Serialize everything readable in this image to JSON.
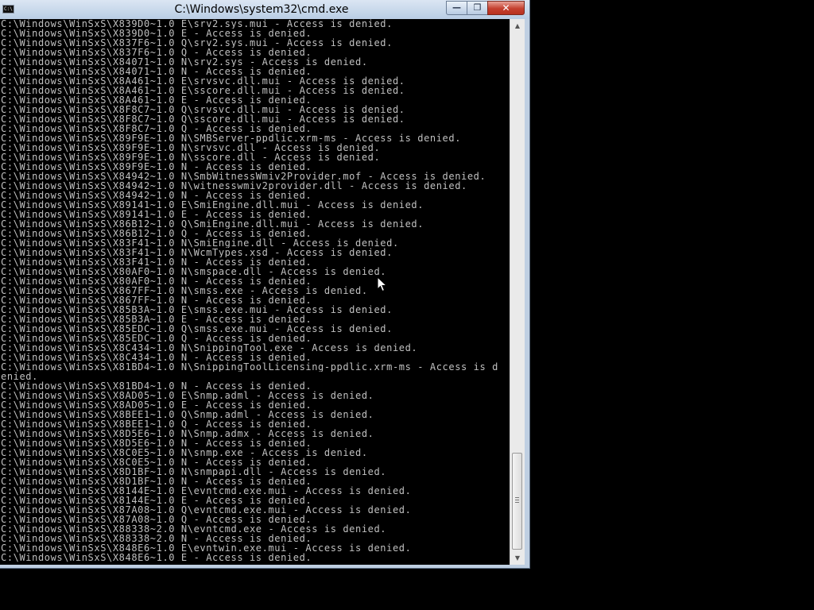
{
  "window": {
    "title": "C:\\Windows\\system32\\cmd.exe",
    "icon_text": "C:\\",
    "minimize_symbol": "—",
    "maximize_symbol": "❐",
    "close_symbol": "✕"
  },
  "scrollbar": {
    "up_symbol": "▲",
    "down_symbol": "▼",
    "position_fraction": 0.97
  },
  "console": {
    "lines": [
      "C:\\Windows\\WinSxS\\X839D0~1.0_E\\srv2.sys.mui - Access is denied.",
      "C:\\Windows\\WinSxS\\X839D0~1.0_E - Access is denied.",
      "C:\\Windows\\WinSxS\\X837F6~1.0_Q\\srv2.sys.mui - Access is denied.",
      "C:\\Windows\\WinSxS\\X837F6~1.0_Q - Access is denied.",
      "C:\\Windows\\WinSxS\\X84071~1.0_N\\srv2.sys - Access is denied.",
      "C:\\Windows\\WinSxS\\X84071~1.0_N - Access is denied.",
      "C:\\Windows\\WinSxS\\X8A461~1.0_E\\srvsvc.dll.mui - Access is denied.",
      "C:\\Windows\\WinSxS\\X8A461~1.0_E\\sscore.dll.mui - Access is denied.",
      "C:\\Windows\\WinSxS\\X8A461~1.0_E - Access is denied.",
      "C:\\Windows\\WinSxS\\X8F8C7~1.0_Q\\srvsvc.dll.mui - Access is denied.",
      "C:\\Windows\\WinSxS\\X8F8C7~1.0_Q\\sscore.dll.mui - Access is denied.",
      "C:\\Windows\\WinSxS\\X8F8C7~1.0_Q - Access is denied.",
      "C:\\Windows\\WinSxS\\X89F9E~1.0_N\\SMBServer-ppdlic.xrm-ms - Access is denied.",
      "C:\\Windows\\WinSxS\\X89F9E~1.0_N\\srvsvc.dll - Access is denied.",
      "C:\\Windows\\WinSxS\\X89F9E~1.0_N\\sscore.dll - Access is denied.",
      "C:\\Windows\\WinSxS\\X89F9E~1.0_N - Access is denied.",
      "C:\\Windows\\WinSxS\\X84942~1.0_N\\SmbWitnessWmiv2Provider.mof - Access is denied.",
      "C:\\Windows\\WinSxS\\X84942~1.0_N\\witnesswmiv2provider.dll - Access is denied.",
      "C:\\Windows\\WinSxS\\X84942~1.0_N - Access is denied.",
      "C:\\Windows\\WinSxS\\X89141~1.0_E\\SmiEngine.dll.mui - Access is denied.",
      "C:\\Windows\\WinSxS\\X89141~1.0_E - Access is denied.",
      "C:\\Windows\\WinSxS\\X86B12~1.0_Q\\SmiEngine.dll.mui - Access is denied.",
      "C:\\Windows\\WinSxS\\X86B12~1.0_Q - Access is denied.",
      "C:\\Windows\\WinSxS\\X83F41~1.0_N\\SmiEngine.dll - Access is denied.",
      "C:\\Windows\\WinSxS\\X83F41~1.0_N\\WcmTypes.xsd - Access is denied.",
      "C:\\Windows\\WinSxS\\X83F41~1.0_N - Access is denied.",
      "C:\\Windows\\WinSxS\\X80AF0~1.0_N\\smspace.dll - Access is denied.",
      "C:\\Windows\\WinSxS\\X80AF0~1.0_N - Access is denied.",
      "C:\\Windows\\WinSxS\\X867FF~1.0_N\\smss.exe - Access is denied.",
      "C:\\Windows\\WinSxS\\X867FF~1.0_N - Access is denied.",
      "C:\\Windows\\WinSxS\\X85B3A~1.0_E\\smss.exe.mui - Access is denied.",
      "C:\\Windows\\WinSxS\\X85B3A~1.0_E - Access is denied.",
      "C:\\Windows\\WinSxS\\X85EDC~1.0_Q\\smss.exe.mui - Access is denied.",
      "C:\\Windows\\WinSxS\\X85EDC~1.0_Q - Access is denied.",
      "C:\\Windows\\WinSxS\\X8C434~1.0_N\\SnippingTool.exe - Access is denied.",
      "C:\\Windows\\WinSxS\\X8C434~1.0_N - Access is denied.",
      "C:\\Windows\\WinSxS\\X81BD4~1.0_N\\SnippingToolLicensing-ppdlic.xrm-ms - Access is d",
      "enied.",
      "C:\\Windows\\WinSxS\\X81BD4~1.0_N - Access is denied.",
      "C:\\Windows\\WinSxS\\X8AD05~1.0_E\\Snmp.adml - Access is denied.",
      "C:\\Windows\\WinSxS\\X8AD05~1.0_E - Access is denied.",
      "C:\\Windows\\WinSxS\\X8BEE1~1.0_Q\\Snmp.adml - Access is denied.",
      "C:\\Windows\\WinSxS\\X8BEE1~1.0_Q - Access is denied.",
      "C:\\Windows\\WinSxS\\X8D5E6~1.0_N\\Snmp.admx - Access is denied.",
      "C:\\Windows\\WinSxS\\X8D5E6~1.0_N - Access is denied.",
      "C:\\Windows\\WinSxS\\X8C0E5~1.0_N\\snmp.exe - Access is denied.",
      "C:\\Windows\\WinSxS\\X8C0E5~1.0_N - Access is denied.",
      "C:\\Windows\\WinSxS\\X8D1BF~1.0_N\\snmpapi.dll - Access is denied.",
      "C:\\Windows\\WinSxS\\X8D1BF~1.0_N - Access is denied.",
      "C:\\Windows\\WinSxS\\X8144E~1.0_E\\evntcmd.exe.mui - Access is denied.",
      "C:\\Windows\\WinSxS\\X8144E~1.0_E - Access is denied.",
      "C:\\Windows\\WinSxS\\X87A08~1.0_Q\\evntcmd.exe.mui - Access is denied.",
      "C:\\Windows\\WinSxS\\X87A08~1.0_Q - Access is denied.",
      "C:\\Windows\\WinSxS\\X88338~2.0_N\\evntcmd.exe - Access is denied.",
      "C:\\Windows\\WinSxS\\X88338~2.0_N - Access is denied.",
      "C:\\Windows\\WinSxS\\X848E6~1.0_E\\evntwin.exe.mui - Access is denied.",
      "C:\\Windows\\WinSxS\\X848E6~1.0_E - Access is denied."
    ]
  },
  "colors": {
    "console_background": "#000000",
    "console_text": "#c0c0c0",
    "titlebar": "#c7d8ec",
    "close_button": "#c4402f"
  }
}
